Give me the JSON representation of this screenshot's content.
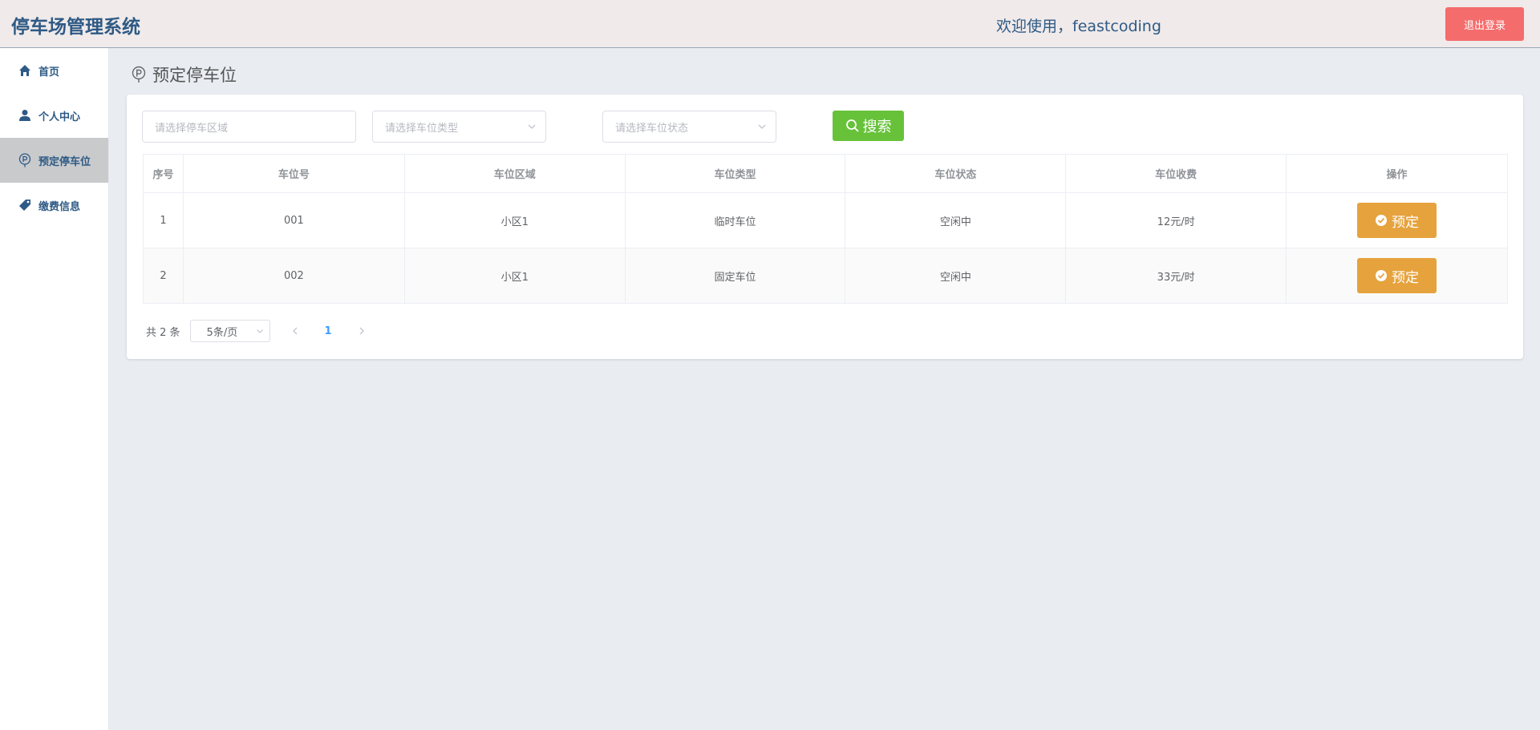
{
  "header": {
    "app_title": "停车场管理系统",
    "welcome": "欢迎使用，feastcoding",
    "logout_label": "退出登录"
  },
  "sidebar": {
    "items": [
      {
        "label": "首页",
        "icon": "home-icon"
      },
      {
        "label": "个人中心",
        "icon": "user-icon"
      },
      {
        "label": "预定停车位",
        "icon": "parking-icon",
        "active": true
      },
      {
        "label": "缴费信息",
        "icon": "tag-icon"
      }
    ]
  },
  "page": {
    "title": "预定停车位"
  },
  "filters": {
    "area_placeholder": "请选择停车区域",
    "type_placeholder": "请选择车位类型",
    "status_placeholder": "请选择车位状态",
    "search_label": "搜索"
  },
  "table": {
    "headers": [
      "序号",
      "车位号",
      "车位区域",
      "车位类型",
      "车位状态",
      "车位收费",
      "操作"
    ],
    "rows": [
      {
        "index": "1",
        "number": "001",
        "area": "小区1",
        "type": "临时车位",
        "status": "空闲中",
        "fee": "12元/时",
        "action": "预定"
      },
      {
        "index": "2",
        "number": "002",
        "area": "小区1",
        "type": "固定车位",
        "status": "空闲中",
        "fee": "33元/时",
        "action": "预定"
      }
    ]
  },
  "pagination": {
    "total": "共 2 条",
    "page_size": "5条/页",
    "current_page": "1"
  },
  "colors": {
    "brand": "#2e5a85",
    "danger": "#f56c6c",
    "success": "#67c23a",
    "warning": "#e6a23c",
    "primary": "#409eff"
  }
}
